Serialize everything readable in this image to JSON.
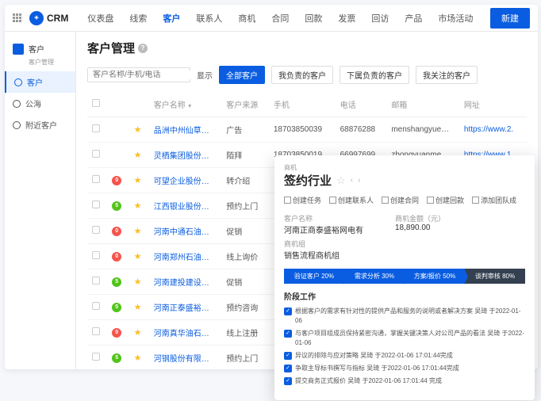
{
  "app_name": "CRM",
  "nav": [
    "仪表盘",
    "线索",
    "客户",
    "联系人",
    "商机",
    "合同",
    "回款",
    "发票",
    "回访",
    "产品",
    "市场活动"
  ],
  "nav_active": 2,
  "new_btn": "新建",
  "sidebar": {
    "title": "客户",
    "subtitle": "客户管理",
    "items": [
      {
        "label": "客户",
        "active": true
      },
      {
        "label": "公海",
        "active": false
      },
      {
        "label": "附近客户",
        "active": false
      }
    ]
  },
  "page_title": "客户管理",
  "search_placeholder": "客户名称/手机/电话",
  "display_label": "显示",
  "filters": [
    "全部客户",
    "我负责的客户",
    "下属负责的客户",
    "我关注的客户"
  ],
  "columns": [
    "",
    "",
    "",
    "客户名称",
    "客户来源",
    "手机",
    "电话",
    "邮箱",
    "网址"
  ],
  "rows": [
    {
      "badge": "",
      "star": true,
      "name": "品洲中州仙草娱乐…",
      "source": "广告",
      "mobile": "18703850039",
      "tel": "68876288",
      "email": "menshangyue…",
      "url": "https://www.2."
    },
    {
      "badge": "",
      "star": true,
      "name": "灵栖集团股份有限…",
      "source": "陌拜",
      "mobile": "18703850019",
      "tel": "66997699",
      "email": "zhongyuanme…",
      "url": "https://www.1."
    },
    {
      "badge": "red",
      "star": true,
      "name": "可望企业股份有限…",
      "source": "转介绍",
      "mobile": "",
      "tel": "",
      "email": "",
      "url": ""
    },
    {
      "badge": "green",
      "star": true,
      "name": "江西银业股份有限…",
      "source": "预约上门",
      "mobile": "",
      "tel": "",
      "email": "",
      "url": ""
    },
    {
      "badge": "red",
      "star": true,
      "name": "河南中通石油有限…",
      "source": "促销",
      "mobile": "",
      "tel": "",
      "email": "",
      "url": ""
    },
    {
      "badge": "red",
      "star": true,
      "name": "河南郑州石油集团…",
      "source": "线上询价",
      "mobile": "",
      "tel": "",
      "email": "",
      "url": ""
    },
    {
      "badge": "green",
      "star": true,
      "name": "河南建投建设股份…",
      "source": "促销",
      "mobile": "",
      "tel": "",
      "email": "",
      "url": ""
    },
    {
      "badge": "green",
      "star": true,
      "name": "河南正泰盛裕网电…",
      "source": "预约咨询",
      "mobile": "",
      "tel": "",
      "email": "",
      "url": ""
    },
    {
      "badge": "red",
      "star": true,
      "name": "河南真华油石集团…",
      "source": "线上注册",
      "mobile": "",
      "tel": "",
      "email": "",
      "url": ""
    },
    {
      "badge": "green",
      "star": true,
      "name": "河钢股份有限公司…",
      "source": "预约上门",
      "mobile": "",
      "tel": "",
      "email": "",
      "url": ""
    }
  ],
  "panel": {
    "badge": "商机",
    "title": "签约行业",
    "actions": [
      "创建任务",
      "创建联系人",
      "创建合同",
      "创建回款",
      "添加团队成"
    ],
    "info": [
      {
        "label": "客户名称",
        "value": "河南正商泰盛裕网电有"
      },
      {
        "label": "商机金额（元）",
        "value": "18,890.00"
      },
      {
        "label": "商机组",
        "value": "销售流程商机组"
      }
    ],
    "stages": [
      {
        "label": "验证客户",
        "pct": "20%",
        "cls": "blue"
      },
      {
        "label": "需求分析",
        "pct": "30%",
        "cls": "blue"
      },
      {
        "label": "方案/报价",
        "pct": "50%",
        "cls": "blue"
      },
      {
        "label": "谈判审核",
        "pct": "80%",
        "cls": "dark"
      }
    ],
    "section": "阶段工作",
    "tasks": [
      "根据客户的需求有针对性的提供产品和服务的说明或者解决方案 吴琦 于2022-01-06",
      "与客户项目组成员保持紧密沟通，掌握关键决策人对公司产品的看法 吴琦 于2022-01-06",
      "异议的排除与应对策略 吴琦 于2022-01-06 17:01:44完成",
      "争取主导标书撰写与指标 吴琦 于2022-01-06 17:01:44完成",
      "提交商务正式报价 吴琦 于2022-01-06 17:01:44 完成"
    ]
  }
}
